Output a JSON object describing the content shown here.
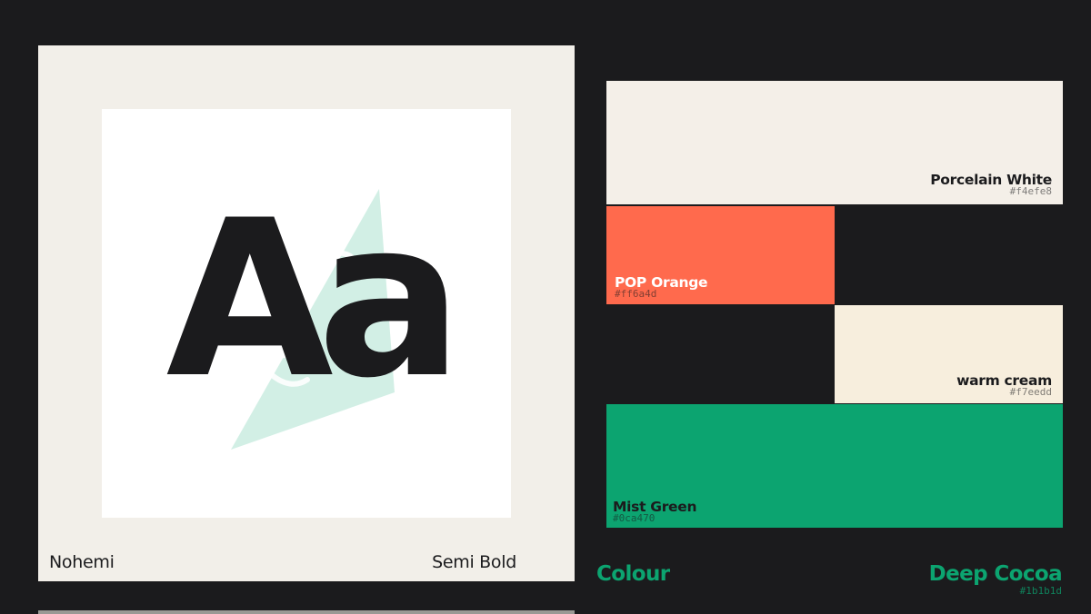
{
  "typeface": {
    "sample_glyphs": "Aa",
    "family": "Nohemi",
    "weight": "Semi Bold",
    "sample_color": "#1b1b1d",
    "watermark_icon": "mint-play-triangle-icon",
    "watermark_color": "#d2efe5"
  },
  "palette": {
    "section_label": "Colour",
    "swatches": [
      {
        "name": "Porcelain White",
        "hex": "#f4efe8"
      },
      {
        "name": "POP Orange",
        "hex": "#ff6a4d"
      },
      {
        "name": "warm cream",
        "hex": "#f7eedd"
      },
      {
        "name": "Mist Green",
        "hex": "#0ca470"
      }
    ],
    "background_swatch": {
      "name": "Deep Cocoa",
      "hex": "#1b1b1d"
    }
  }
}
